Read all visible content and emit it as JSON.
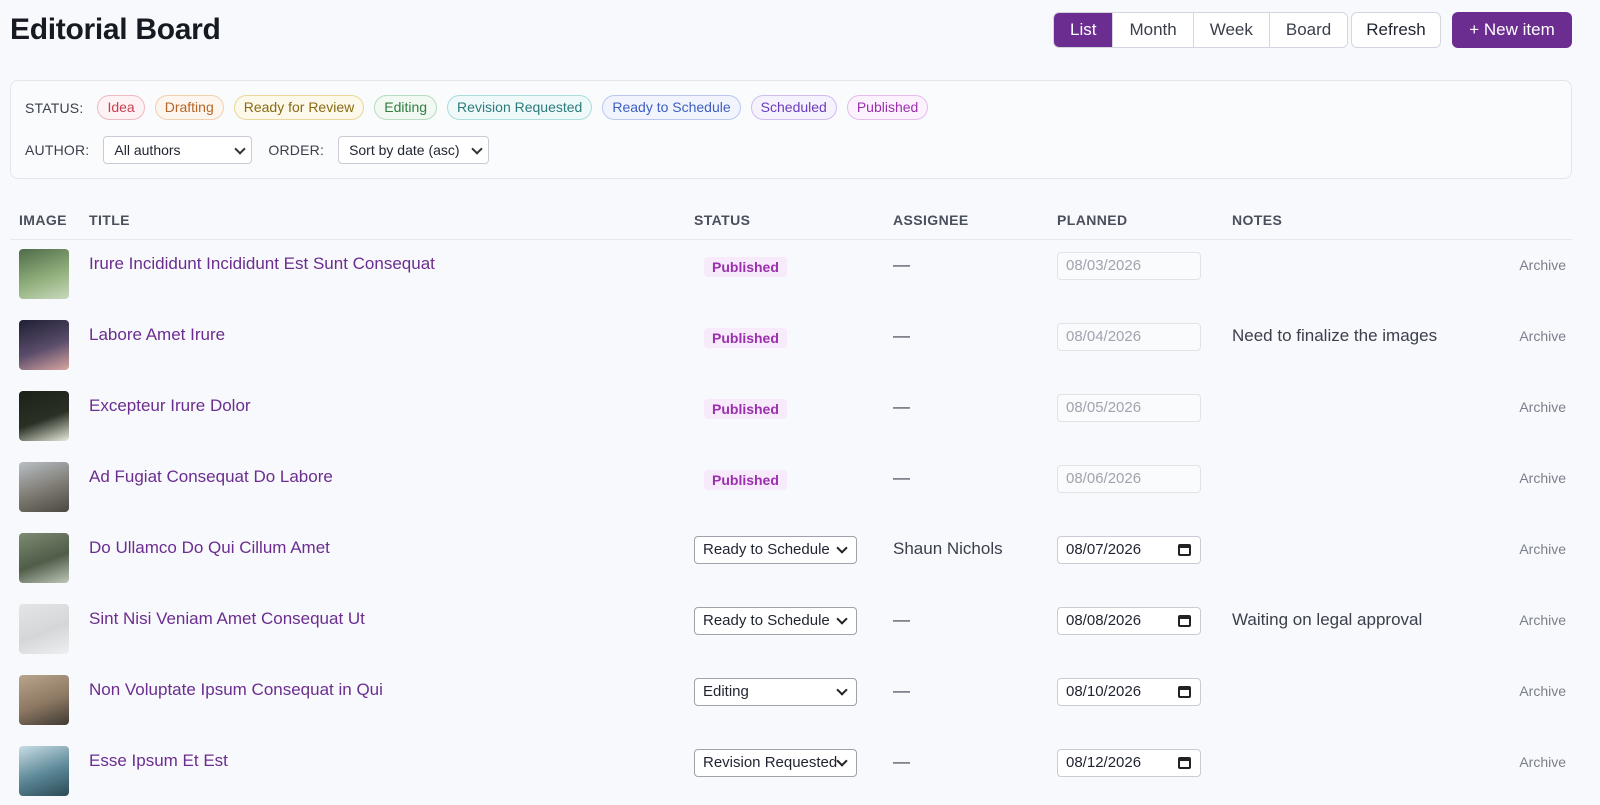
{
  "header": {
    "title": "Editorial Board",
    "views": [
      "List",
      "Month",
      "Week",
      "Board"
    ],
    "active_view": "List",
    "refresh_label": "Refresh",
    "new_item_label": "+ New item"
  },
  "filters": {
    "status_label": "STATUS:",
    "statuses": [
      {
        "label": "Idea",
        "color": "#c94052",
        "border": "#f0b8c0",
        "bg": "#fdf2f4"
      },
      {
        "label": "Drafting",
        "color": "#b5652a",
        "border": "#f1cfae",
        "bg": "#fdf6ef"
      },
      {
        "label": "Ready for Review",
        "color": "#8a6a14",
        "border": "#e8d79b",
        "bg": "#fcf9ea"
      },
      {
        "label": "Editing",
        "color": "#2f7d3f",
        "border": "#b7dcbf",
        "bg": "#f1f9f2"
      },
      {
        "label": "Revision Requested",
        "color": "#2c7b7c",
        "border": "#acdcdc",
        "bg": "#eff9f9"
      },
      {
        "label": "Ready to Schedule",
        "color": "#3e5fc1",
        "border": "#bac8f0",
        "bg": "#f1f4fd"
      },
      {
        "label": "Scheduled",
        "color": "#6a3cbd",
        "border": "#cfbdef",
        "bg": "#f5f1fd"
      },
      {
        "label": "Published",
        "color": "#9b2fae",
        "border": "#e5bdec",
        "bg": "#fbf2fd"
      }
    ],
    "author_label": "AUTHOR:",
    "author_value": "All authors",
    "order_label": "ORDER:",
    "order_value": "Sort by date (asc)"
  },
  "table": {
    "headers": {
      "image": "IMAGE",
      "title": "TITLE",
      "status": "STATUS",
      "assignee": "ASSIGNEE",
      "planned": "PLANNED",
      "notes": "NOTES"
    },
    "archive_label": "Archive",
    "rows": [
      {
        "title": "Irure Incididunt Incididunt Est Sunt Consequat",
        "status": "Published",
        "status_editable": false,
        "assignee": "—",
        "planned": "08/03/2026",
        "notes": "",
        "thumb": [
          "#4f6b4a",
          "#8fae7a",
          "#c9d9bd"
        ]
      },
      {
        "title": "Labore Amet Irure",
        "status": "Published",
        "status_editable": false,
        "assignee": "—",
        "planned": "08/04/2026",
        "notes": "Need to finalize the images",
        "thumb": [
          "#1d1f33",
          "#5a4c6b",
          "#d9a6a0"
        ]
      },
      {
        "title": "Excepteur Irure Dolor",
        "status": "Published",
        "status_editable": false,
        "assignee": "—",
        "planned": "08/05/2026",
        "notes": "",
        "thumb": [
          "#1c2118",
          "#2a3024",
          "#e7ecde"
        ]
      },
      {
        "title": "Ad Fugiat Consequat Do Labore",
        "status": "Published",
        "status_editable": false,
        "assignee": "—",
        "planned": "08/06/2026",
        "notes": "",
        "thumb": [
          "#b8bfc5",
          "#7d7a72",
          "#4c4841"
        ]
      },
      {
        "title": "Do Ullamco Do Qui Cillum Amet",
        "status": "Ready to Schedule",
        "status_editable": true,
        "assignee": "Shaun Nichols",
        "planned": "08/07/2026",
        "notes": "",
        "thumb": [
          "#7d8b73",
          "#4f5d49",
          "#c0c7b8"
        ]
      },
      {
        "title": "Sint Nisi Veniam Amet Consequat Ut",
        "status": "Ready to Schedule",
        "status_editable": true,
        "assignee": "—",
        "planned": "08/08/2026",
        "notes": "Waiting on legal approval",
        "thumb": [
          "#e4e5e6",
          "#d4d6d8",
          "#eeeff0"
        ]
      },
      {
        "title": "Non Voluptate Ipsum Consequat in Qui",
        "status": "Editing",
        "status_editable": true,
        "assignee": "—",
        "planned": "08/10/2026",
        "notes": "",
        "thumb": [
          "#b9a48d",
          "#8c7762",
          "#3f3a33"
        ]
      },
      {
        "title": "Esse Ipsum Et Est",
        "status": "Revision Requested",
        "status_editable": true,
        "assignee": "—",
        "planned": "08/12/2026",
        "notes": "",
        "thumb": [
          "#c8dde4",
          "#5a8696",
          "#2b4a55"
        ]
      }
    ]
  }
}
